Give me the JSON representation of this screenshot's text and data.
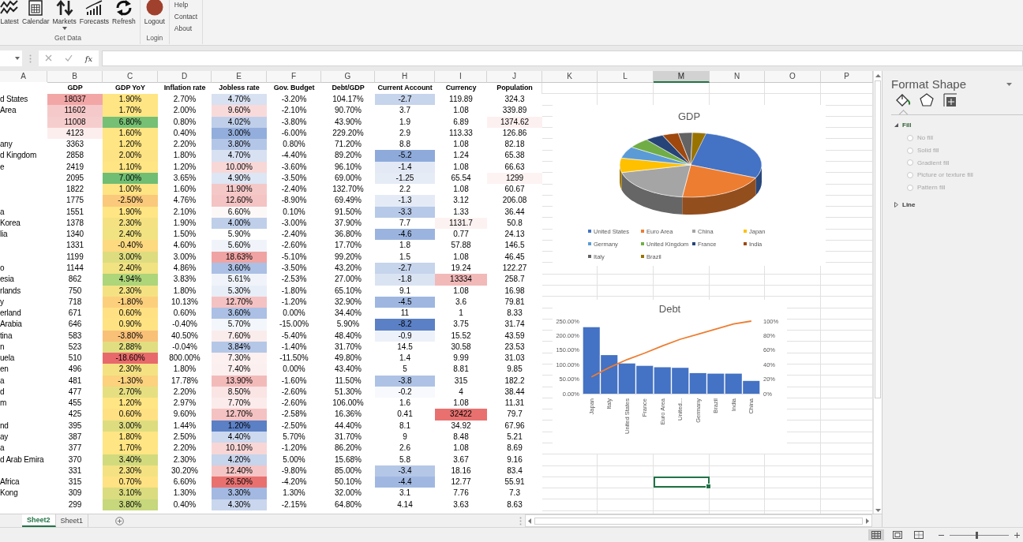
{
  "ribbon": {
    "groups": [
      {
        "label": "Get Data",
        "buttons": [
          {
            "label": "Latest",
            "kind": "wave",
            "dropdown": false
          },
          {
            "label": "Calendar",
            "kind": "calendar",
            "dropdown": false
          },
          {
            "label": "Markets",
            "kind": "arrows",
            "dropdown": true
          },
          {
            "label": "Forecasts",
            "kind": "bars",
            "dropdown": false
          },
          {
            "label": "Refresh",
            "kind": "refresh",
            "dropdown": false
          }
        ]
      },
      {
        "label": "Login",
        "buttons": [
          {
            "label": "Logout",
            "kind": "circle",
            "dropdown": false
          }
        ]
      }
    ],
    "links": [
      "Help",
      "Contact",
      "About"
    ]
  },
  "formula_bar": {
    "function_label": "fx"
  },
  "sheet": {
    "columns": [
      {
        "label": "A",
        "selected": false
      },
      {
        "label": "B",
        "selected": false
      },
      {
        "label": "C",
        "selected": false
      },
      {
        "label": "D",
        "selected": false
      },
      {
        "label": "E",
        "selected": false
      },
      {
        "label": "F",
        "selected": false
      },
      {
        "label": "G",
        "selected": false
      },
      {
        "label": "H",
        "selected": false
      },
      {
        "label": "I",
        "selected": false
      },
      {
        "label": "J",
        "selected": false
      },
      {
        "label": "K",
        "selected": false
      },
      {
        "label": "L",
        "selected": false
      },
      {
        "label": "M",
        "selected": true
      },
      {
        "label": "N",
        "selected": false
      },
      {
        "label": "O",
        "selected": false
      },
      {
        "label": "P",
        "selected": false
      }
    ],
    "headers": [
      "GDP",
      "GDP YoY",
      "Inflation rate",
      "Jobless rate",
      "Gov. Budget",
      "Debt/GDP",
      "Current Account",
      "Currency",
      "Population"
    ],
    "rows": [
      {
        "active": false,
        "cells": [
          "d States",
          {
            "text": "18037",
            "color": "#f2a6a6"
          },
          {
            "text": "1.90%",
            "color": "#ffe583"
          },
          "2.70%",
          {
            "text": "4.70%",
            "color": "#d7e1f2"
          },
          "-3.20%",
          "104.17%",
          {
            "text": "-2.7",
            "color": "#c6d4ec"
          },
          "119.89",
          "324.3"
        ]
      },
      {
        "active": false,
        "cells": [
          "Area",
          {
            "text": "11602",
            "color": "#f5c9c9"
          },
          {
            "text": "1.70%",
            "color": "#ffe583"
          },
          "2.00%",
          {
            "text": "9.60%",
            "color": "#f9dada"
          },
          "-2.10%",
          "90.70%",
          "3.7",
          "1.08",
          "339.89"
        ]
      },
      {
        "active": false,
        "cells": [
          "",
          {
            "text": "11008",
            "color": "#f6cdcd"
          },
          {
            "text": "6.80%",
            "color": "#75c074"
          },
          "0.80%",
          {
            "text": "4.02%",
            "color": "#bfcfea"
          },
          "-3.80%",
          "43.90%",
          "1.9",
          "6.89",
          {
            "text": "1374.62",
            "color": "#fdf0f0"
          }
        ]
      },
      {
        "active": false,
        "cells": [
          "",
          {
            "text": "4123",
            "color": "#fdeeee"
          },
          {
            "text": "1.60%",
            "color": "#ffe583"
          },
          "0.40%",
          {
            "text": "3.00%",
            "color": "#93aedc"
          },
          "-6.00%",
          "229.20%",
          "2.9",
          "113.33",
          "126.86"
        ]
      },
      {
        "active": false,
        "cells": [
          "any",
          "3363",
          {
            "text": "1.20%",
            "color": "#ffe583"
          },
          "2.20%",
          {
            "text": "3.80%",
            "color": "#b3c6e7"
          },
          "0.80%",
          "71.20%",
          "8.8",
          "1.08",
          "82.18"
        ]
      },
      {
        "active": false,
        "cells": [
          "d Kingdom",
          "2858",
          {
            "text": "2.00%",
            "color": "#fde383"
          },
          "1.80%",
          {
            "text": "4.70%",
            "color": "#d7e1f2"
          },
          "-4.40%",
          "89.20%",
          {
            "text": "-5.2",
            "color": "#8eaadb"
          },
          "1.24",
          "65.38"
        ]
      },
      {
        "active": false,
        "cells": [
          "e",
          "2419",
          {
            "text": "1.10%",
            "color": "#ffe583"
          },
          "1.20%",
          {
            "text": "10.00%",
            "color": "#f8d7d7"
          },
          "-3.60%",
          "96.10%",
          {
            "text": "-1.4",
            "color": "#e3e9f5"
          },
          "1.08",
          "66.63"
        ]
      },
      {
        "active": false,
        "cells": [
          "",
          "2095",
          {
            "text": "7.00%",
            "color": "#6fbe73"
          },
          "3.65%",
          {
            "text": "4.90%",
            "color": "#dde6f4"
          },
          "-3.50%",
          "69.00%",
          {
            "text": "-1.25",
            "color": "#e6ecf6"
          },
          "65.54",
          {
            "text": "1299",
            "color": "#fdf3f3"
          }
        ]
      },
      {
        "active": false,
        "cells": [
          "",
          "1822",
          {
            "text": "1.00%",
            "color": "#ffe483"
          },
          "1.60%",
          {
            "text": "11.90%",
            "color": "#f5c8c8"
          },
          "-2.40%",
          "132.70%",
          "2.2",
          "1.08",
          "60.67"
        ]
      },
      {
        "active": false,
        "cells": [
          "",
          "1775",
          {
            "text": "-2.50%",
            "color": "#fbc97b"
          },
          "4.76%",
          {
            "text": "12.60%",
            "color": "#f4c3c3"
          },
          "-8.90%",
          "69.49%",
          {
            "text": "-1.3",
            "color": "#e5ebf6"
          },
          "3.12",
          "206.08"
        ]
      },
      {
        "active": false,
        "cells": [
          "a",
          "1551",
          {
            "text": "1.90%",
            "color": "#ffe583"
          },
          "2.10%",
          {
            "text": "6.60%",
            "color": "#fdf8f8"
          },
          "0.10%",
          "91.50%",
          {
            "text": "-3.3",
            "color": "#b7c9e8"
          },
          "1.33",
          "36.44"
        ]
      },
      {
        "active": false,
        "cells": [
          "Korea",
          "1378",
          {
            "text": "2.30%",
            "color": "#f4e282"
          },
          "1.90%",
          {
            "text": "4.00%",
            "color": "#bfcfea"
          },
          "-3.00%",
          "37.90%",
          "7.7",
          {
            "text": "1131.7",
            "color": "#fdf2f2"
          },
          "50.8"
        ]
      },
      {
        "active": false,
        "cells": [
          "lia",
          "1340",
          {
            "text": "2.40%",
            "color": "#f1e282"
          },
          "1.50%",
          "5.90%",
          "-2.40%",
          "36.80%",
          {
            "text": "-4.6",
            "color": "#9bb4df"
          },
          "0.77",
          "24.13"
        ]
      },
      {
        "active": false,
        "cells": [
          "",
          "1331",
          {
            "text": "-0.40%",
            "color": "#fdd980"
          },
          "4.60%",
          {
            "text": "5.60%",
            "color": "#f0f4fa"
          },
          "-2.60%",
          "17.70%",
          "1.8",
          "57.88",
          "146.5"
        ]
      },
      {
        "active": false,
        "cells": [
          "",
          "1199",
          {
            "text": "3.00%",
            "color": "#dddd80"
          },
          "3.00%",
          {
            "text": "18.63%",
            "color": "#efa3a3"
          },
          "-5.10%",
          "99.20%",
          "1.5",
          "1.08",
          "46.45"
        ]
      },
      {
        "active": false,
        "cells": [
          "o",
          "1144",
          {
            "text": "2.40%",
            "color": "#f1e282"
          },
          "4.86%",
          {
            "text": "3.60%",
            "color": "#abc0e4"
          },
          "-3.50%",
          "43.20%",
          {
            "text": "-2.7",
            "color": "#c6d4ec"
          },
          "19.24",
          "122.27"
        ]
      },
      {
        "active": false,
        "cells": [
          "esia",
          "862",
          {
            "text": "4.94%",
            "color": "#add57a"
          },
          "3.83%",
          {
            "text": "5.61%",
            "color": "#f0f4fa"
          },
          "-2.53%",
          "27.00%",
          {
            "text": "-1.8",
            "color": "#dae3f2"
          },
          {
            "text": "13334",
            "color": "#f2b9b9"
          },
          "258.7"
        ]
      },
      {
        "active": false,
        "cells": [
          "rlands",
          "750",
          {
            "text": "2.30%",
            "color": "#f4e282"
          },
          "1.80%",
          {
            "text": "5.30%",
            "color": "#e8eef7"
          },
          "-1.80%",
          "65.10%",
          "9.1",
          "1.08",
          "16.98"
        ]
      },
      {
        "active": false,
        "cells": [
          "y",
          "718",
          {
            "text": "-1.80%",
            "color": "#fccf7d"
          },
          "10.13%",
          {
            "text": "12.70%",
            "color": "#f4c2c2"
          },
          "-1.20%",
          "32.90%",
          {
            "text": "-4.5",
            "color": "#9eb6e0"
          },
          "3.6",
          "79.81"
        ]
      },
      {
        "active": false,
        "cells": [
          "erland",
          "671",
          {
            "text": "0.60%",
            "color": "#ffe183"
          },
          "0.60%",
          {
            "text": "3.60%",
            "color": "#abc0e4"
          },
          "0.00%",
          "34.40%",
          "11",
          "1",
          "8.33"
        ]
      },
      {
        "active": false,
        "cells": [
          "Arabia",
          "646",
          {
            "text": "0.90%",
            "color": "#ffe383"
          },
          "-0.40%",
          {
            "text": "5.70%",
            "color": "#f3f6fb"
          },
          "-15.00%",
          "5.90%",
          {
            "text": "-8.2",
            "color": "#5b80c5"
          },
          "3.75",
          "31.74"
        ]
      },
      {
        "active": false,
        "cells": [
          "tina",
          "583",
          {
            "text": "-3.80%",
            "color": "#f9c078"
          },
          "40.50%",
          {
            "text": "7.60%",
            "color": "#fbecec"
          },
          "-5.40%",
          "48.40%",
          {
            "text": "-0.9",
            "color": "#edf1f9"
          },
          "15.52",
          "43.59"
        ]
      },
      {
        "active": false,
        "cells": [
          "n",
          "523",
          {
            "text": "2.88%",
            "color": "#e0de80"
          },
          "-0.04%",
          {
            "text": "3.84%",
            "color": "#b5c7e7"
          },
          "-1.40%",
          "31.70%",
          "14.5",
          "30.58",
          "23.53"
        ]
      },
      {
        "active": false,
        "cells": [
          "uela",
          "510",
          {
            "text": "-18.60%",
            "color": "#e8696b"
          },
          "800.00%",
          {
            "text": "7.30%",
            "color": "#fcf0f0"
          },
          "-11.50%",
          "49.80%",
          "1.4",
          "9.99",
          "31.03"
        ]
      },
      {
        "active": false,
        "cells": [
          "en",
          "496",
          {
            "text": "2.30%",
            "color": "#f4e282"
          },
          "1.80%",
          {
            "text": "7.40%",
            "color": "#fcefef"
          },
          "0.00%",
          "43.40%",
          "5",
          "8.81",
          "9.85"
        ]
      },
      {
        "active": false,
        "cells": [
          "a",
          "481",
          {
            "text": "-1.30%",
            "color": "#fcd27e"
          },
          "17.78%",
          {
            "text": "13.90%",
            "color": "#f3baba"
          },
          "-1.60%",
          "11.50%",
          {
            "text": "-3.8",
            "color": "#aec2e5"
          },
          "315",
          "182.2"
        ]
      },
      {
        "active": false,
        "cells": [
          "d",
          "477",
          {
            "text": "2.70%",
            "color": "#e6df81"
          },
          "2.20%",
          {
            "text": "8.50%",
            "color": "#fae4e4"
          },
          "-2.60%",
          "51.30%",
          {
            "text": "-0.2",
            "color": "#f7f9fc"
          },
          "4",
          "38.44"
        ]
      },
      {
        "active": false,
        "cells": [
          "m",
          "455",
          {
            "text": "1.20%",
            "color": "#ffe583"
          },
          "2.97%",
          {
            "text": "7.70%",
            "color": "#fbebeb"
          },
          "-2.60%",
          "106.00%",
          "1.6",
          "1.08",
          "11.31"
        ]
      },
      {
        "active": false,
        "cells": [
          "",
          "425",
          {
            "text": "0.60%",
            "color": "#ffe183"
          },
          "9.60%",
          {
            "text": "12.70%",
            "color": "#f4c2c2"
          },
          "-2.58%",
          "16.36%",
          "0.41",
          {
            "text": "32422",
            "color": "#e8716f"
          },
          "79.7"
        ]
      },
      {
        "active": false,
        "cells": [
          "nd",
          "395",
          {
            "text": "3.00%",
            "color": "#dddd80"
          },
          "1.44%",
          {
            "text": "1.20%",
            "color": "#5b80c5"
          },
          "-2.50%",
          "44.40%",
          "8.1",
          "34.92",
          "67.96"
        ]
      },
      {
        "active": false,
        "cells": [
          "ay",
          "387",
          {
            "text": "1.80%",
            "color": "#ffe583"
          },
          "2.50%",
          {
            "text": "4.40%",
            "color": "#cdd9ee"
          },
          "5.70%",
          "31.70%",
          "9",
          "8.48",
          "5.21"
        ]
      },
      {
        "active": false,
        "cells": [
          "a",
          "377",
          {
            "text": "1.70%",
            "color": "#ffe583"
          },
          "2.20%",
          {
            "text": "10.10%",
            "color": "#f8d6d6"
          },
          "-1.20%",
          "86.20%",
          "2.6",
          "1.08",
          "8.69"
        ]
      },
      {
        "active": false,
        "cells": [
          "d Arab Emira",
          "370",
          {
            "text": "3.40%",
            "color": "#d2da7e"
          },
          "2.30%",
          {
            "text": "4.20%",
            "color": "#c6d4ec"
          },
          "5.00%",
          "15.68%",
          "5.8",
          "3.67",
          "9.16"
        ]
      },
      {
        "active": false,
        "cells": [
          "",
          "331",
          {
            "text": "2.30%",
            "color": "#f4e282"
          },
          "30.20%",
          {
            "text": "12.40%",
            "color": "#f5c5c5"
          },
          "-9.80%",
          "85.00%",
          {
            "text": "-3.4",
            "color": "#b5c7e7"
          },
          "18.16",
          "83.4"
        ]
      },
      {
        "active": true,
        "cells": [
          "Africa",
          "315",
          {
            "text": "0.70%",
            "color": "#ffe283"
          },
          "6.60%",
          {
            "text": "26.50%",
            "color": "#e8716f"
          },
          "-4.20%",
          "50.10%",
          {
            "text": "-4.4",
            "color": "#a0b8e1"
          },
          "12.77",
          "55.91"
        ]
      },
      {
        "active": false,
        "cells": [
          "Kong",
          "309",
          {
            "text": "3.10%",
            "color": "#dadc7f"
          },
          "1.30%",
          {
            "text": "3.30%",
            "color": "#a3b9e1"
          },
          "1.30%",
          "32.00%",
          "3.1",
          "7.76",
          "7.3"
        ]
      },
      {
        "active": false,
        "cells": [
          "",
          "299",
          {
            "text": "3.80%",
            "color": "#c6d77c"
          },
          "0.40%",
          {
            "text": "4.30%",
            "color": "#c9d6ed"
          },
          "-2.15%",
          "64.80%",
          "4.14",
          "3.63",
          "8.63"
        ]
      }
    ]
  },
  "gdp_chart": {
    "title": "GDP",
    "legend": [
      {
        "label": "United States",
        "color": "#4472c4"
      },
      {
        "label": "Euro Area",
        "color": "#ed7d31"
      },
      {
        "label": "China",
        "color": "#a5a5a5"
      },
      {
        "label": "Japan",
        "color": "#ffc000"
      },
      {
        "label": "Germany",
        "color": "#5b9bd5"
      },
      {
        "label": "United Kingdom",
        "color": "#70ad47"
      },
      {
        "label": "France",
        "color": "#264478"
      },
      {
        "label": "India",
        "color": "#9e480e"
      },
      {
        "label": "Italy",
        "color": "#636363"
      },
      {
        "label": "Brazil",
        "color": "#997300"
      }
    ]
  },
  "debt_chart": {
    "chart_data": {
      "type": "bar",
      "title": "Debt",
      "categories": [
        "Japan",
        "Italy",
        "United States",
        "France",
        "Euro Area",
        "United...",
        "Germany",
        "Brazil",
        "India",
        "China"
      ],
      "series": [
        {
          "color": "#4472c4",
          "values": [
            229,
            133,
            104,
            96,
            91,
            89,
            71,
            69,
            69,
            44
          ]
        },
        {
          "color": "#ed7d31",
          "type": "line",
          "axis": "y2",
          "values": [
            23,
            36,
            47,
            56,
            66,
            75,
            82,
            89,
            96,
            100
          ]
        }
      ],
      "ylim": [
        0,
        250
      ],
      "yticks": [
        {
          "value": 0,
          "label": "0.00%"
        },
        {
          "value": 50,
          "label": "50.00%"
        },
        {
          "value": 100,
          "label": "100.00%"
        },
        {
          "value": 150,
          "label": "150.00%"
        },
        {
          "value": 200,
          "label": "200.00%"
        },
        {
          "value": 250,
          "label": "250.00%"
        }
      ],
      "y2lim": [
        0,
        100
      ],
      "y2ticks": [
        {
          "value": 0,
          "label": "0%"
        },
        {
          "value": 20,
          "label": "20%"
        },
        {
          "value": 40,
          "label": "40%"
        },
        {
          "value": 60,
          "label": "60%"
        },
        {
          "value": 80,
          "label": "80%"
        },
        {
          "value": 100,
          "label": "100%"
        }
      ]
    }
  },
  "format_pane": {
    "title": "Format Shape",
    "tabs": [
      {
        "kind": "fill",
        "selected": true
      },
      {
        "kind": "effects",
        "selected": false
      },
      {
        "kind": "size",
        "selected": false
      }
    ],
    "sections": [
      {
        "label": "Fill",
        "expanded": true,
        "options": [
          {
            "label": "No fill",
            "selected": false,
            "disabled": true
          },
          {
            "label": "Solid fill",
            "selected": false,
            "disabled": true
          },
          {
            "label": "Gradient fill",
            "selected": false,
            "disabled": true
          },
          {
            "label": "Picture or texture fill",
            "selected": false,
            "disabled": true
          },
          {
            "label": "Pattern fill",
            "selected": false,
            "disabled": true
          }
        ]
      },
      {
        "label": "Line",
        "expanded": false
      }
    ]
  },
  "sheet_tabs": [
    {
      "label": "Sheet2",
      "selected": true
    },
    {
      "label": "Sheet1",
      "selected": false
    }
  ],
  "status_bar": {
    "views": [
      {
        "kind": "normal",
        "selected": true
      },
      {
        "kind": "layout",
        "selected": false
      },
      {
        "kind": "pagebreak",
        "selected": false
      }
    ],
    "zoom_slider": {
      "level": 0.45
    }
  }
}
